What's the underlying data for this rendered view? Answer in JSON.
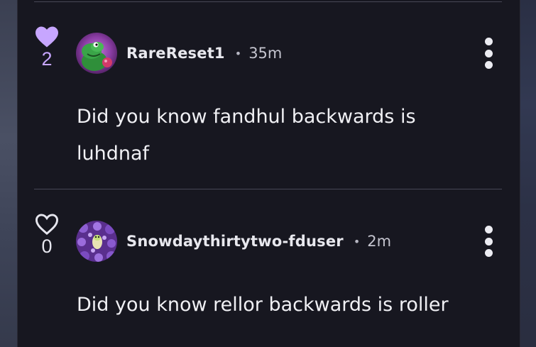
{
  "colors": {
    "panel_bg": "#171720",
    "liked_heart": "#c7a6ff",
    "text": "#f0f0f4"
  },
  "comments": [
    {
      "liked": true,
      "like_count": "2",
      "heart_icon": "heart-filled-icon",
      "username": "RareReset1",
      "separator": "•",
      "time": "35m",
      "text_line1": "Did you know fandhul backwards is",
      "text_line2": "luhdnaf",
      "menu_icon": "more-options-icon"
    },
    {
      "liked": false,
      "like_count": "0",
      "heart_icon": "heart-outline-icon",
      "username": "Snowdaythirtytwo-fduser",
      "separator": "•",
      "time": "2m",
      "text_line1": "Did you know rellor backwards is roller",
      "menu_icon": "more-options-icon"
    }
  ]
}
